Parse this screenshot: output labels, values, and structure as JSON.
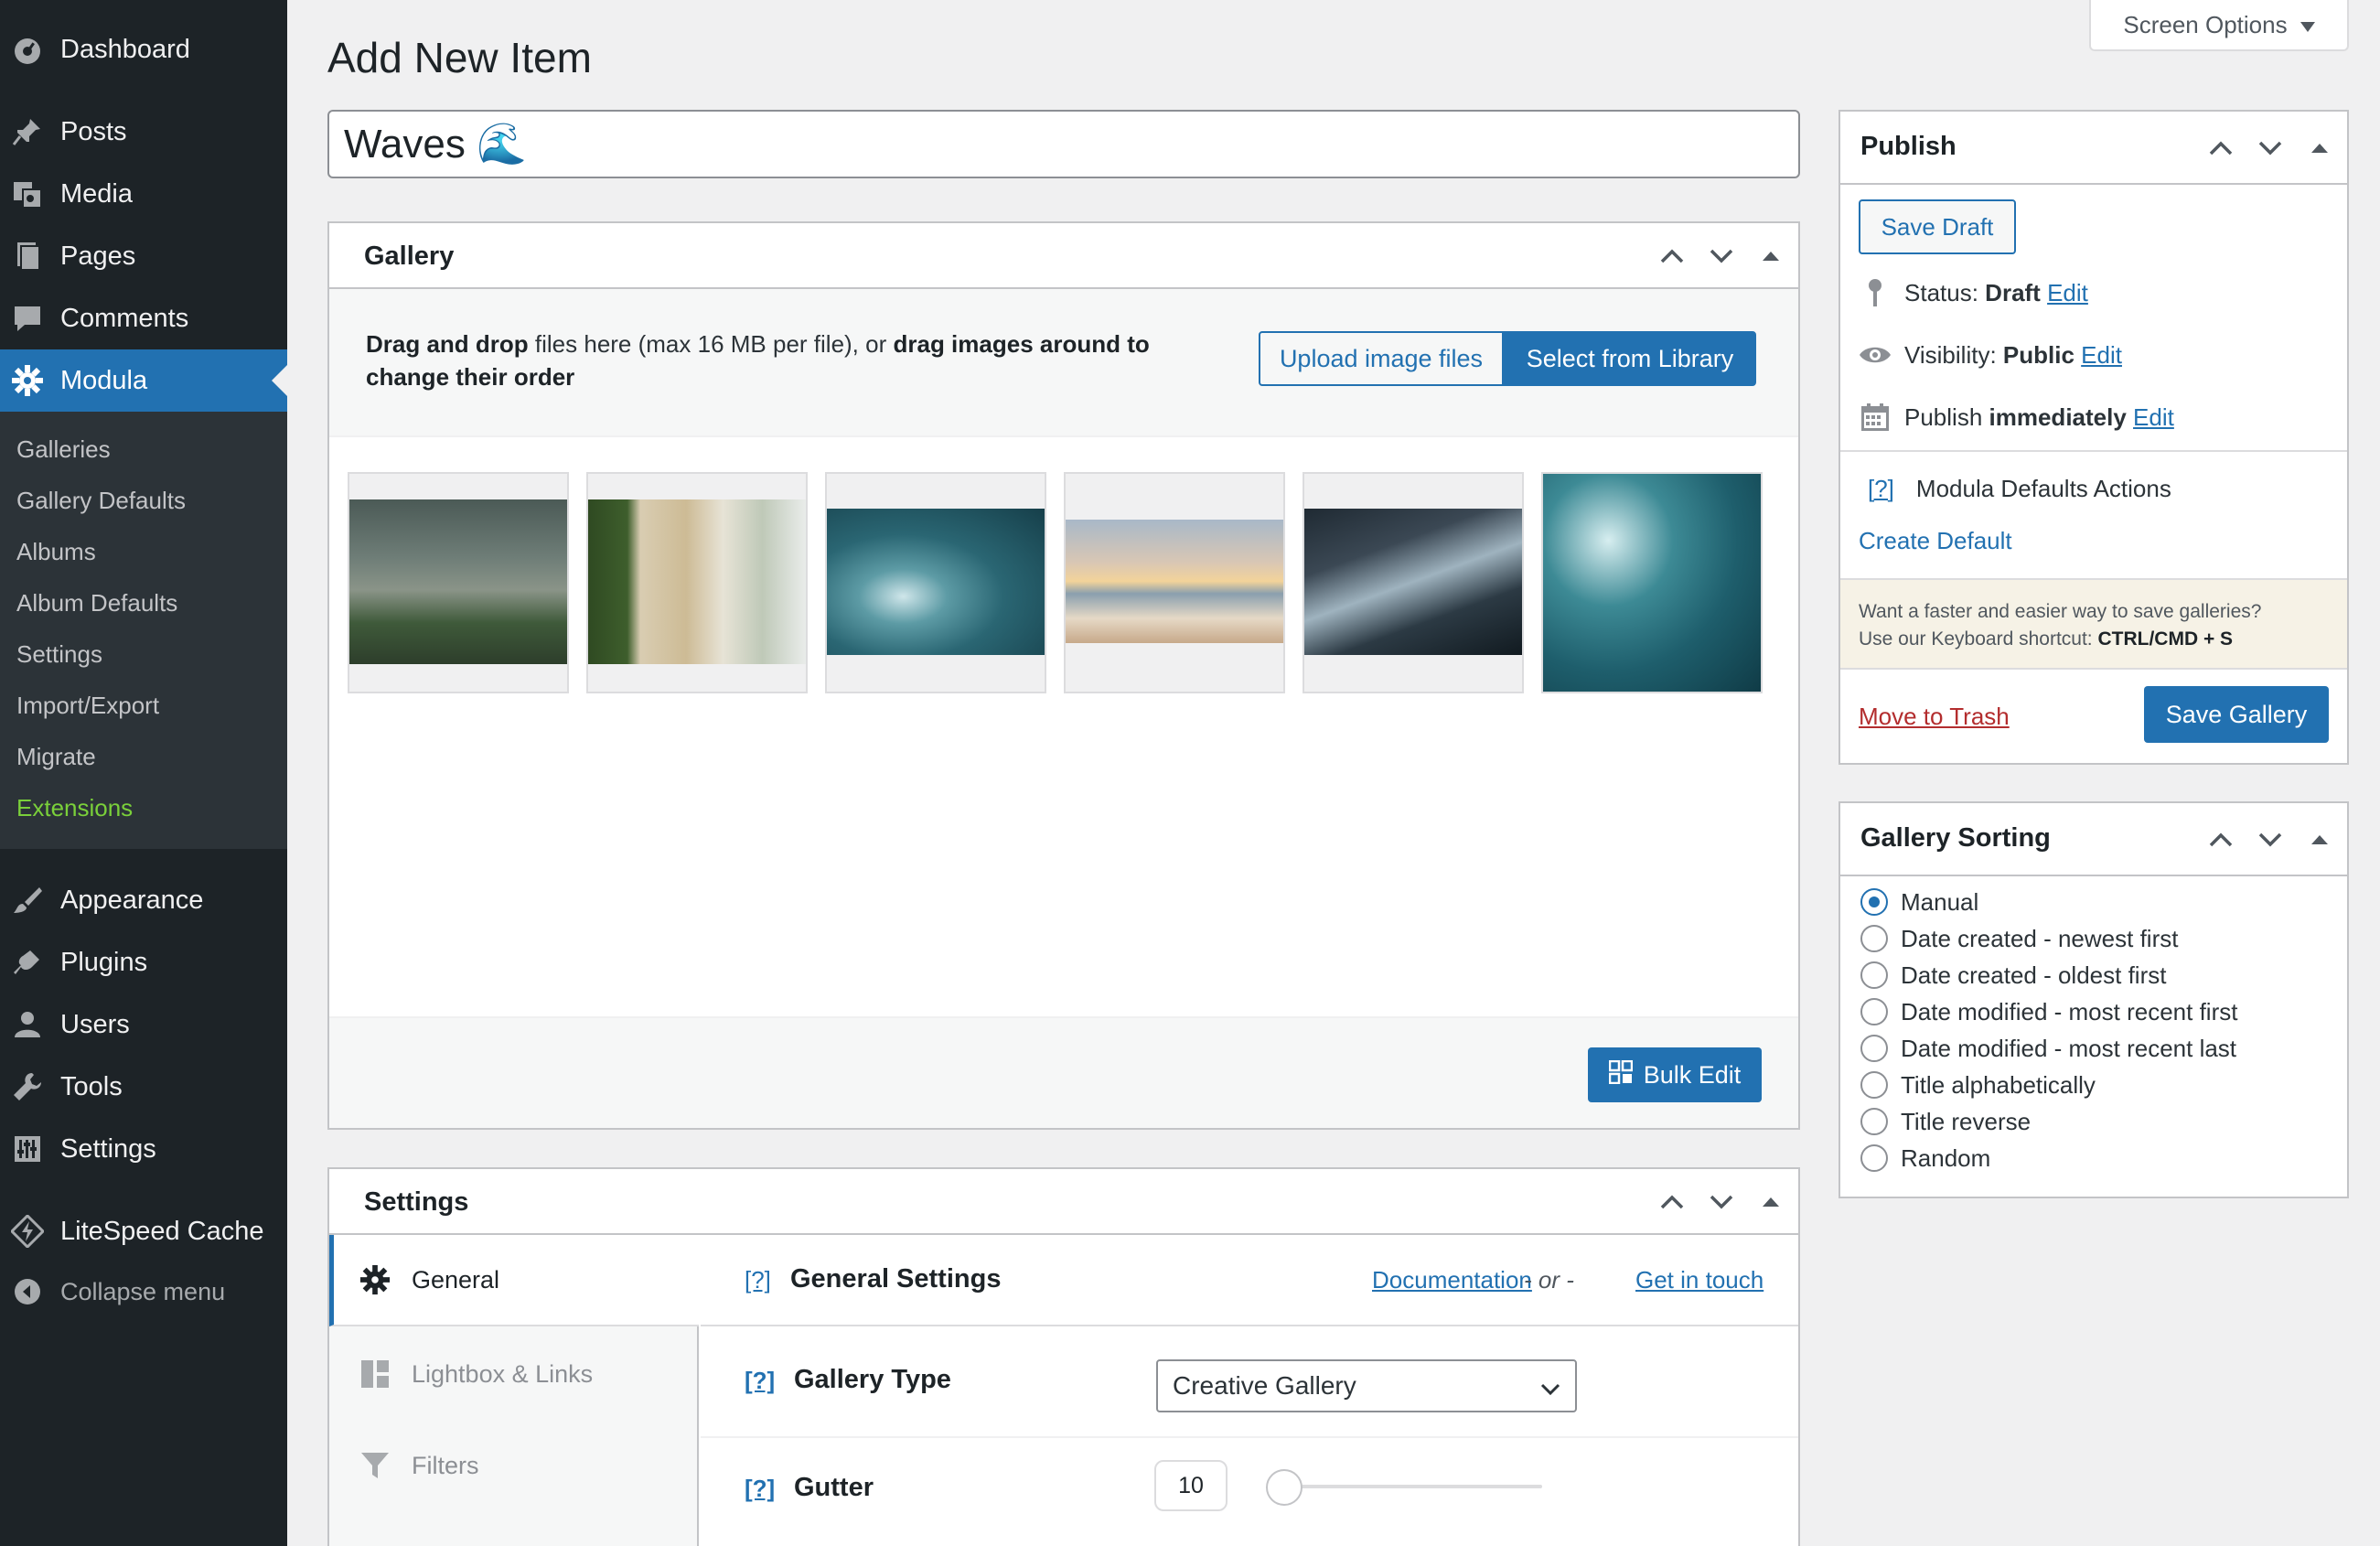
{
  "sidebar": {
    "menu": [
      {
        "label": "Dashboard",
        "icon": "dashboard-icon"
      },
      {
        "label": "Posts",
        "icon": "pin-icon"
      },
      {
        "label": "Media",
        "icon": "media-icon"
      },
      {
        "label": "Pages",
        "icon": "pages-icon"
      },
      {
        "label": "Comments",
        "icon": "comment-icon"
      },
      {
        "label": "Modula",
        "icon": "modula-gear-icon",
        "current": true
      },
      {
        "label": "Appearance",
        "icon": "brush-icon"
      },
      {
        "label": "Plugins",
        "icon": "plug-icon"
      },
      {
        "label": "Users",
        "icon": "user-icon"
      },
      {
        "label": "Tools",
        "icon": "wrench-icon"
      },
      {
        "label": "Settings",
        "icon": "sliders-icon"
      },
      {
        "label": "LiteSpeed Cache",
        "icon": "litespeed-icon"
      }
    ],
    "submenu": [
      "Galleries",
      "Gallery Defaults",
      "Albums",
      "Album Defaults",
      "Settings",
      "Import/Export",
      "Migrate",
      "Extensions"
    ],
    "collapse_label": "Collapse menu"
  },
  "header": {
    "screen_options": "Screen Options",
    "page_title": "Add New Item",
    "title_value": "Waves 🌊"
  },
  "gallery": {
    "title": "Gallery",
    "upload_text_bold1": "Drag and drop",
    "upload_text_mid": " files here (max 16 MB per file), or ",
    "upload_text_bold2": "drag images around to change their order",
    "upload_button": "Upload image files",
    "library_button": "Select from Library",
    "bulk_edit": "Bulk Edit",
    "images": [
      "aerial coast",
      "sandy shoreline",
      "curling wave",
      "pier sunset",
      "rocky coast",
      "aerial rocks and sea"
    ]
  },
  "settings": {
    "title": "Settings",
    "tabs": [
      "General",
      "Lightbox & Links",
      "Filters"
    ],
    "help": "[?]",
    "section_title": "General Settings",
    "documentation": "Documentation",
    "or": "- or -",
    "get_in_touch": "Get in touch",
    "gallery_type_label": "Gallery Type",
    "gallery_type_value": "Creative Gallery",
    "gutter_label": "Gutter",
    "gutter_value": "10"
  },
  "publish": {
    "title": "Publish",
    "save_draft": "Save Draft",
    "status_label": "Status:",
    "status_value": "Draft",
    "visibility_label": "Visibility:",
    "visibility_value": "Public",
    "publish_label": "Publish",
    "publish_value": "immediately",
    "edit": "Edit",
    "defaults_help": "[?]",
    "defaults_actions": "Modula Defaults Actions",
    "create_default": "Create Default",
    "notice_line1": "Want a faster and easier way to save galleries?",
    "notice_line2": "Use our Keyboard shortcut: ",
    "notice_shortcut": "CTRL/CMD + S",
    "move_to_trash": "Move to Trash",
    "save_gallery": "Save Gallery"
  },
  "sorting": {
    "title": "Gallery Sorting",
    "options": [
      "Manual",
      "Date created - newest first",
      "Date created - oldest first",
      "Date modified - most recent first",
      "Date modified - most recent last",
      "Title alphabetically",
      "Title reverse",
      "Random"
    ],
    "selected": "Manual"
  },
  "colors": {
    "accent": "#2271b1",
    "sidebar_bg": "#1d2327",
    "submenu_bg": "#2c3338",
    "extensions_green": "#7ad03a",
    "trash_red": "#b32d2e"
  }
}
